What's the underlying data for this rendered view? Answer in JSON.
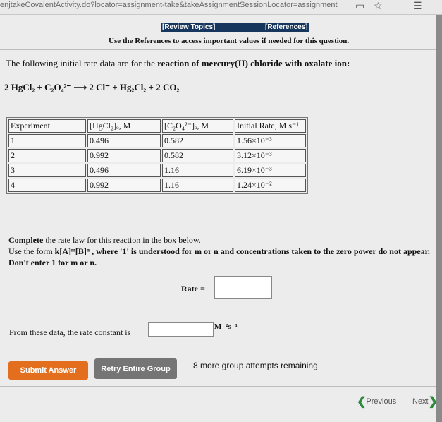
{
  "browser": {
    "url": "enjtakeCovalentActivity.do?locator=assignment-take&takeAssignmentSessionLocator=assignment",
    "star_icon": "star-icon",
    "collections_icon": "collections-icon"
  },
  "header": {
    "review_topics": "[Review Topics]",
    "references": "[References]",
    "use_refs": "Use the References to access important values if needed for this question."
  },
  "question": {
    "intro_plain": "The following initial rate data are for the ",
    "intro_bold": "reaction of mercury(II) chloride with oxalate ion:",
    "equation": "2 HgCl₂ + C₂O₄²⁻ ⟶ 2 Cl⁻ + Hg₂Cl₂ + 2 CO₂"
  },
  "table": {
    "headers": [
      "Experiment",
      "[HgCl₂]ₒ, M",
      "[C₂O₄²⁻]ₒ, M",
      "Initial Rate, M s⁻¹"
    ],
    "rows": [
      [
        "1",
        "0.496",
        "0.582",
        "1.56×10⁻³"
      ],
      [
        "2",
        "0.992",
        "0.582",
        "3.12×10⁻³"
      ],
      [
        "3",
        "0.496",
        "1.16",
        "6.19×10⁻³"
      ],
      [
        "4",
        "0.992",
        "1.16",
        "1.24×10⁻²"
      ]
    ]
  },
  "instructions": {
    "line1_bold": "Complete",
    "line1_rest": " the rate law for this reaction in the box below.",
    "line2_a": "Use the form ",
    "line2_form": "k[A]ᵐ[B]ⁿ",
    "line2_b": " , where '1' is understood for m or n",
    "line2_c": " and concentrations taken to the zero power do not appear. Don't enter 1 for m or n."
  },
  "rate_law": {
    "label": "Rate =",
    "value": ""
  },
  "rate_constant": {
    "label": "From these data, the rate constant is",
    "value": "",
    "units": "M⁻²s⁻¹"
  },
  "buttons": {
    "submit": "Submit Answer",
    "retry": "Retry Entire Group",
    "attempts": "8 more group attempts remaining"
  },
  "nav": {
    "previous": "Previous",
    "next": "Next"
  },
  "colors": {
    "submit": "#e36f1e",
    "retry": "#757575",
    "refbar": "#16365d",
    "nav_arrow": "#2c8a3a"
  }
}
